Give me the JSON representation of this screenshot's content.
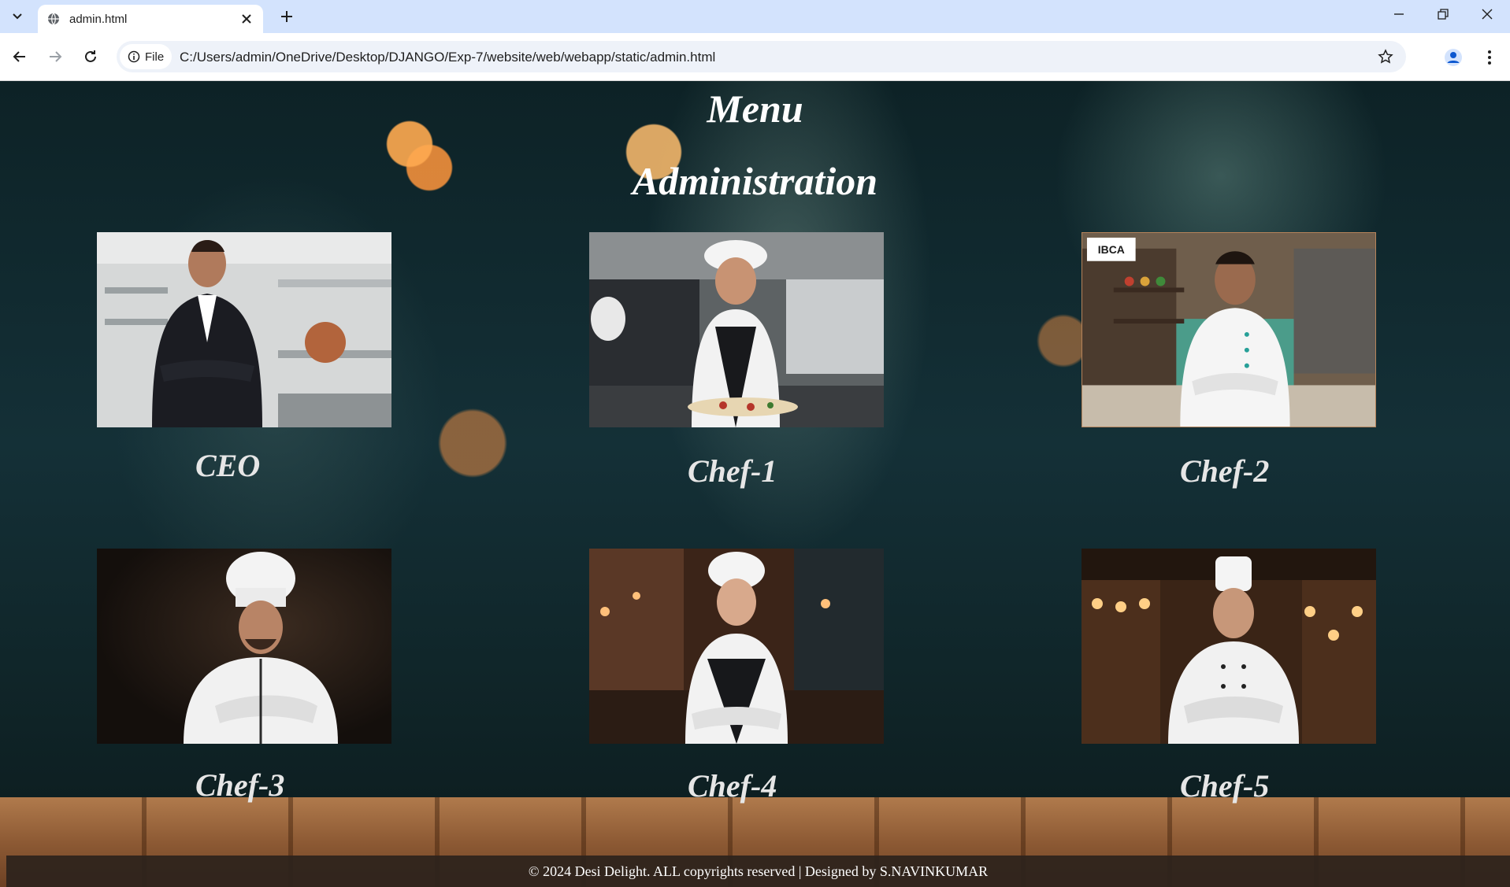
{
  "browser": {
    "tab_title": "admin.html",
    "site_chip_label": "File",
    "url": "C:/Users/admin/OneDrive/Desktop/DJANGO/Exp-7/website/web/webapp/static/admin.html"
  },
  "page": {
    "heading_1": "Menu",
    "heading_2": "Administration",
    "members": [
      {
        "label": "CEO",
        "image": "ceo-photo"
      },
      {
        "label": "Chef-1",
        "image": "chef-1-photo"
      },
      {
        "label": "Chef-2",
        "image": "chef-2-photo"
      },
      {
        "label": "Chef-3",
        "image": "chef-3-photo"
      },
      {
        "label": "Chef-4",
        "image": "chef-4-photo"
      },
      {
        "label": "Chef-5",
        "image": "chef-5-photo"
      }
    ],
    "chef2_logo_text": "IBCA",
    "footer": "© 2024 Desi Delight. ALL copyrights reserved | Designed by S.NAVINKUMAR"
  },
  "colors": {
    "tabbar": "#d3e3fd",
    "heading": "#ffffff",
    "footer_bg": "#2d231c"
  }
}
